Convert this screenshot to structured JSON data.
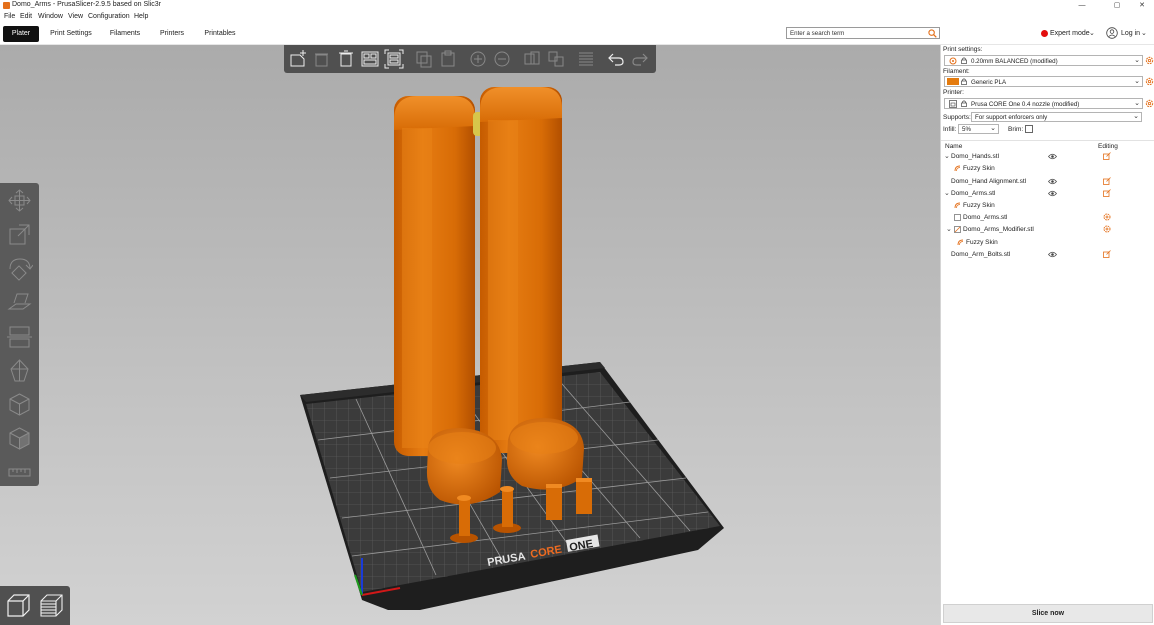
{
  "window": {
    "title": "Domo_Arms - PrusaSlicer-2.9.5 based on Slic3r",
    "minimize": "—",
    "maximize": "▢",
    "close": "✕"
  },
  "menu": [
    "File",
    "Edit",
    "Window",
    "View",
    "Configuration",
    "Help"
  ],
  "tabs": [
    "Plater",
    "Print Settings",
    "Filaments",
    "Printers",
    "Printables"
  ],
  "search": {
    "placeholder": "Enter a search term"
  },
  "mode": {
    "label": "Expert mode",
    "color": "#e30e0e"
  },
  "login": {
    "label": "Log in"
  },
  "sidebar": {
    "print_settings_label": "Print settings:",
    "print_settings_value": "0.20mm BALANCED (modified)",
    "filament_label": "Filament:",
    "filament_value": "Generic PLA",
    "filament_color": "#e47b0e",
    "printer_label": "Printer:",
    "printer_value": "Prusa CORE One 0.4 nozzle (modified)",
    "supports_label": "Supports:",
    "supports_value": "For support enforcers only",
    "infill_label": "Infill:",
    "infill_value": "5%",
    "brim_label": "Brim:",
    "list_header": {
      "name": "Name",
      "editing": "Editing"
    },
    "objects": [
      {
        "label": "Domo_Hands.stl",
        "level": 0,
        "expander": "⌄",
        "eye": true,
        "edit": "object"
      },
      {
        "label": "Fuzzy Skin",
        "level": 1,
        "icon": "fuzzy"
      },
      {
        "label": "Domo_Hand Alignment.stl",
        "level": 0,
        "eye": true,
        "edit": "object"
      },
      {
        "label": "Domo_Arms.stl",
        "level": 0,
        "expander": "⌄",
        "eye": true,
        "edit": "object"
      },
      {
        "label": "Fuzzy Skin",
        "level": 1,
        "icon": "fuzzy"
      },
      {
        "label": "Domo_Arms.stl",
        "level": 1,
        "icon": "part",
        "edit": "gear"
      },
      {
        "label": "Domo_Arms_Modifier.stl",
        "level": 1,
        "icon": "modifier",
        "expander": "⌄",
        "edit": "gear"
      },
      {
        "label": "Fuzzy Skin",
        "level": 2,
        "icon": "fuzzy"
      },
      {
        "label": "Domo_Arm_Bolts.stl",
        "level": 0,
        "eye": true,
        "edit": "object"
      }
    ],
    "slice_button": "Slice now"
  },
  "bed": {
    "brand_left": "PRUSA",
    "brand_mid": "CORE",
    "brand_right": "ONE"
  },
  "colors": {
    "model": "#e47b0e",
    "accent": "#ed6b21",
    "viewport_top": "#ababab",
    "viewport_bottom": "#d2d2d2"
  }
}
